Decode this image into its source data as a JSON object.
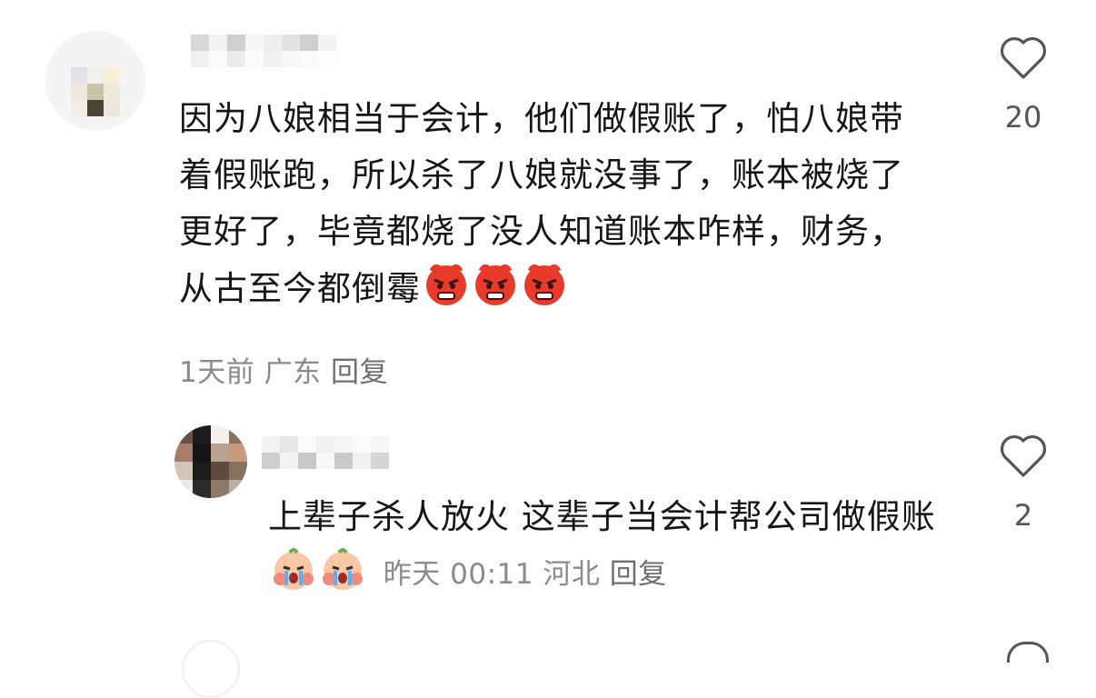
{
  "comments": [
    {
      "text": "因为八娘相当于会计，他们做假账了，怕八娘带着假账跑，所以杀了八娘就没事了，账本被烧了更好了，毕竟都烧了没人知道账本咋样，财务，从古至今都倒霉",
      "emojis": [
        "angry-face-icon",
        "angry-face-icon",
        "angry-face-icon"
      ],
      "time": "1天前",
      "location": "广东",
      "reply_label": "回复",
      "like_count": "20"
    }
  ],
  "replies": [
    {
      "text": "上辈子杀人放火 这辈子当会计帮公司做假账",
      "emojis": [
        "crying-face-icon",
        "crying-face-icon"
      ],
      "time": "昨天 00:11",
      "location": "河北",
      "reply_label": "回复",
      "like_count": "2"
    }
  ]
}
